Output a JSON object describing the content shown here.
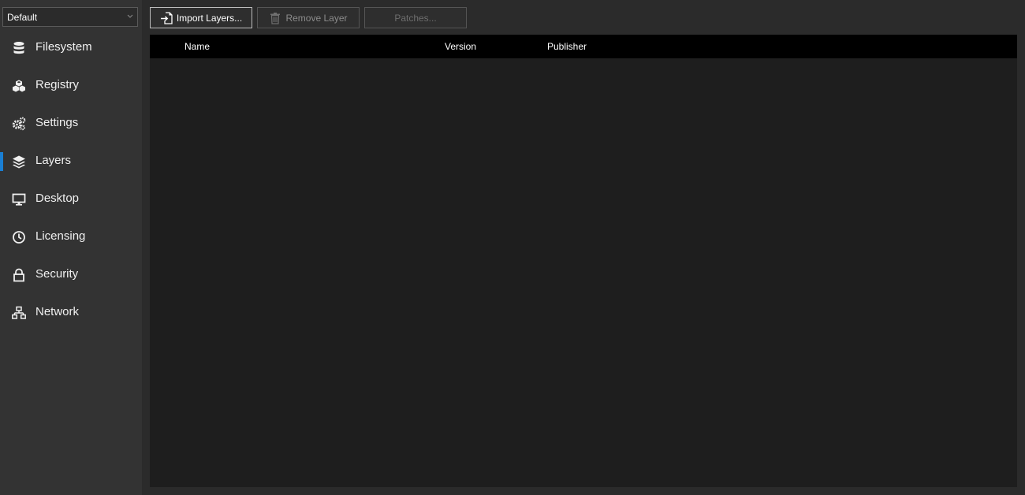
{
  "profile": {
    "selected": "Default"
  },
  "sidebar": {
    "items": [
      {
        "label": "Filesystem",
        "icon": "database-icon",
        "active": false
      },
      {
        "label": "Registry",
        "icon": "registry-icon",
        "active": false
      },
      {
        "label": "Settings",
        "icon": "gears-icon",
        "active": false
      },
      {
        "label": "Layers",
        "icon": "layers-icon",
        "active": true
      },
      {
        "label": "Desktop",
        "icon": "monitor-icon",
        "active": false
      },
      {
        "label": "Licensing",
        "icon": "clock-icon",
        "active": false
      },
      {
        "label": "Security",
        "icon": "lock-icon",
        "active": false
      },
      {
        "label": "Network",
        "icon": "network-icon",
        "active": false
      }
    ],
    "accent_color": "#1a7fd4"
  },
  "toolbar": {
    "import_label": "Import Layers...",
    "remove_label": "Remove Layer",
    "patches_label": "Patches..."
  },
  "table": {
    "columns": [
      "Name",
      "Version",
      "Publisher"
    ],
    "rows": []
  }
}
